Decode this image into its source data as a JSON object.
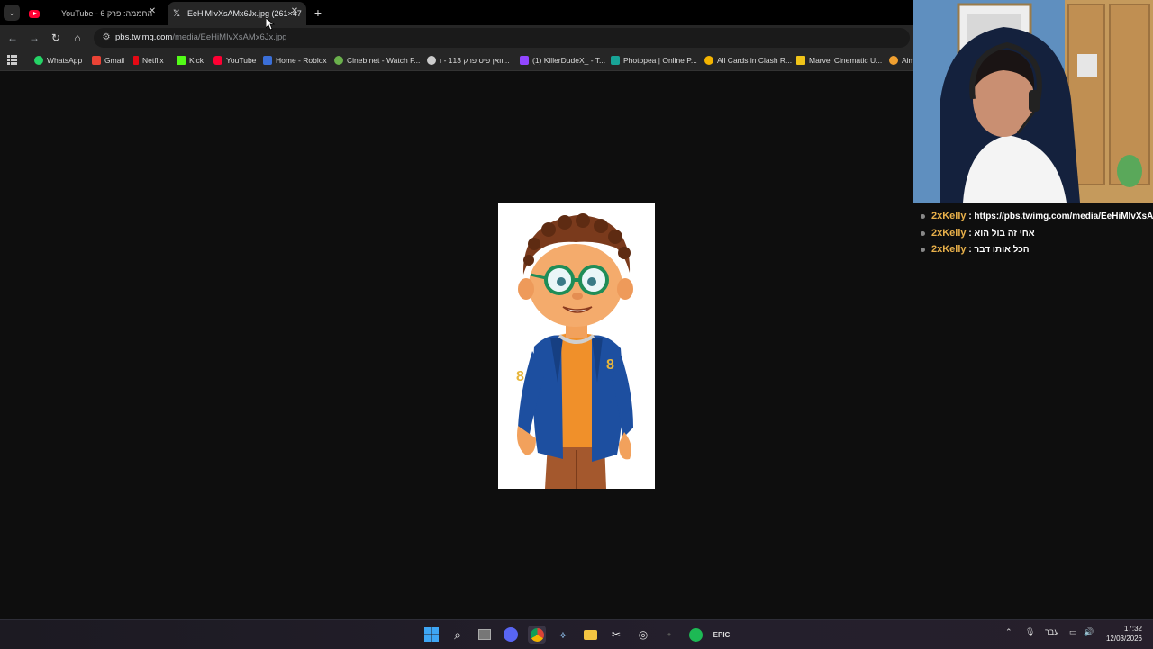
{
  "browser": {
    "tabs": [
      {
        "label": "YouTube - 6 החממה: פרק",
        "active": false
      },
      {
        "label": "EeHiMIvXsAMx6Jx.jpg (261×47",
        "active": true
      }
    ],
    "url_host": "pbs.twimg.com",
    "url_path": "/media/EeHiMIvXsAMx6Jx.jpg",
    "bookmarks": [
      {
        "label": "WhatsApp",
        "color": "#25d366"
      },
      {
        "label": "Gmail",
        "color": "#ea4335"
      },
      {
        "label": "Netflix",
        "color": "#e50914"
      },
      {
        "label": "Kick",
        "color": "#53fc18"
      },
      {
        "label": "YouTube",
        "color": "#ff0033"
      },
      {
        "label": "Home - Roblox",
        "color": "#3b6fd8"
      },
      {
        "label": "Cineb.net - Watch F...",
        "color": "#6ab04c"
      },
      {
        "label": "וואן פיס פרק 113 - ו...",
        "color": "#cccccc"
      },
      {
        "label": "(1) KillerDudeX_ - T...",
        "color": "#9146ff"
      },
      {
        "label": "Photopea | Online P...",
        "color": "#18a497"
      },
      {
        "label": "All Cards in Clash R...",
        "color": "#f4b400"
      },
      {
        "label": "Marvel Cinematic U...",
        "color": "#f0c419"
      },
      {
        "label": "Aim",
        "color": "#f0a030"
      }
    ]
  },
  "chat": {
    "messages": [
      {
        "user": "2xKelly",
        "text": ": https://pbs.twimg.com/media/EeHiMIvXsAM"
      },
      {
        "user": "2xKelly",
        "text": ": אחי זה בול הוא"
      },
      {
        "user": "2xKelly",
        "text": ": הכל אותו דבר"
      }
    ]
  },
  "taskbar": {
    "language": "עבר",
    "time": "17:32",
    "date": "12/03/2026"
  },
  "colors": {
    "accent_jacket": "#1d4fa0",
    "chat_username": "#e8b04a"
  }
}
